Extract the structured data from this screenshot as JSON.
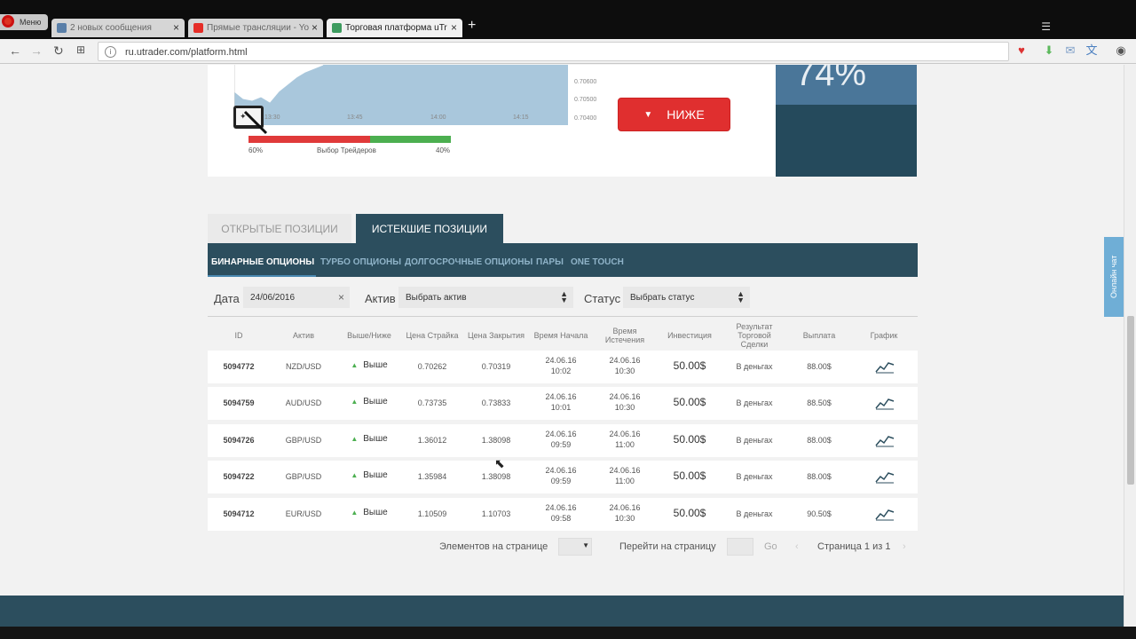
{
  "browser": {
    "menu_label": "Меню",
    "tabs": [
      {
        "label": "2 новых сообщения",
        "active": false
      },
      {
        "label": "Прямые трансляции - Yo",
        "active": false
      },
      {
        "label": "Торговая платформа uTr",
        "active": true
      }
    ],
    "new_tab": "+",
    "url": "ru.utrader.com/platform.html"
  },
  "top_panel": {
    "chart_x_ticks": [
      "13:30",
      "13:45",
      "14:00",
      "14:15"
    ],
    "chart_y_ticks": [
      "0.70600",
      "0.70500",
      "0.70400"
    ],
    "traders_choice_label": "Выбор Трейдеров",
    "traders_left_pct": "60%",
    "traders_right_pct": "40%",
    "traders_left_fraction": 0.6,
    "lower_button": "НИЖЕ",
    "payout_pct": "74%",
    "colors": {
      "red": "#e02f2f",
      "green": "#4caf50",
      "dark": "#254a5c",
      "accent": "#4a7699"
    }
  },
  "position_tabs": [
    {
      "label": "ОТКРЫТЫЕ ПОЗИЦИИ",
      "active": false
    },
    {
      "label": "ИСТЕКШИЕ ПОЗИЦИИ",
      "active": true
    }
  ],
  "subnav": [
    {
      "label": "БИНАРНЫЕ ОПЦИОНЫ",
      "active": true
    },
    {
      "label": "ТУРБО ОПЦИОНЫ",
      "active": false
    },
    {
      "label": "ДОЛГОСРОЧНЫЕ ОПЦИОНЫ",
      "active": false
    },
    {
      "label": "ПАРЫ",
      "active": false
    },
    {
      "label": "ONE TOUCH",
      "active": false
    }
  ],
  "filters": {
    "date_label": "Дата",
    "date_value": "24/06/2016",
    "asset_label": "Актив",
    "asset_placeholder": "Выбрать актив",
    "status_label": "Статус",
    "status_placeholder": "Выбрать статус"
  },
  "table": {
    "headers": {
      "id": "ID",
      "asset": "Актив",
      "direction": "Выше/Ниже",
      "strike": "Цена Страйка",
      "close": "Цена Закрытия",
      "start_1": "Время Начала",
      "expiry_1": "Время",
      "expiry_2": "Истечения",
      "investment": "Инвестиция",
      "result_1": "Результат",
      "result_2": "Торговой",
      "result_3": "Сделки",
      "payout": "Выплата",
      "chart": "График"
    },
    "rows": [
      {
        "id": "5094772",
        "asset": "NZD/USD",
        "direction": "Выше",
        "strike": "0.70262",
        "close": "0.70319",
        "start_date": "24.06.16",
        "start_time": "10:02",
        "exp_date": "24.06.16",
        "exp_time": "10:30",
        "investment": "50.00$",
        "result": "В деньгах",
        "payout": "88.00$"
      },
      {
        "id": "5094759",
        "asset": "AUD/USD",
        "direction": "Выше",
        "strike": "0.73735",
        "close": "0.73833",
        "start_date": "24.06.16",
        "start_time": "10:01",
        "exp_date": "24.06.16",
        "exp_time": "10:30",
        "investment": "50.00$",
        "result": "В деньгах",
        "payout": "88.50$"
      },
      {
        "id": "5094726",
        "asset": "GBP/USD",
        "direction": "Выше",
        "strike": "1.36012",
        "close": "1.38098",
        "start_date": "24.06.16",
        "start_time": "09:59",
        "exp_date": "24.06.16",
        "exp_time": "11:00",
        "investment": "50.00$",
        "result": "В деньгах",
        "payout": "88.00$"
      },
      {
        "id": "5094722",
        "asset": "GBP/USD",
        "direction": "Выше",
        "strike": "1.35984",
        "close": "1.38098",
        "start_date": "24.06.16",
        "start_time": "09:59",
        "exp_date": "24.06.16",
        "exp_time": "11:00",
        "investment": "50.00$",
        "result": "В деньгах",
        "payout": "88.00$"
      },
      {
        "id": "5094712",
        "asset": "EUR/USD",
        "direction": "Выше",
        "strike": "1.10509",
        "close": "1.10703",
        "start_date": "24.06.16",
        "start_time": "09:58",
        "exp_date": "24.06.16",
        "exp_time": "10:30",
        "investment": "50.00$",
        "result": "В деньгах",
        "payout": "90.50$"
      }
    ]
  },
  "pager": {
    "per_page_label": "Элементов на странице",
    "goto_label": "Перейти на страницу",
    "go_button": "Go",
    "page_info": "Страница 1 из 1"
  },
  "chat_label": "Онлайн чат"
}
